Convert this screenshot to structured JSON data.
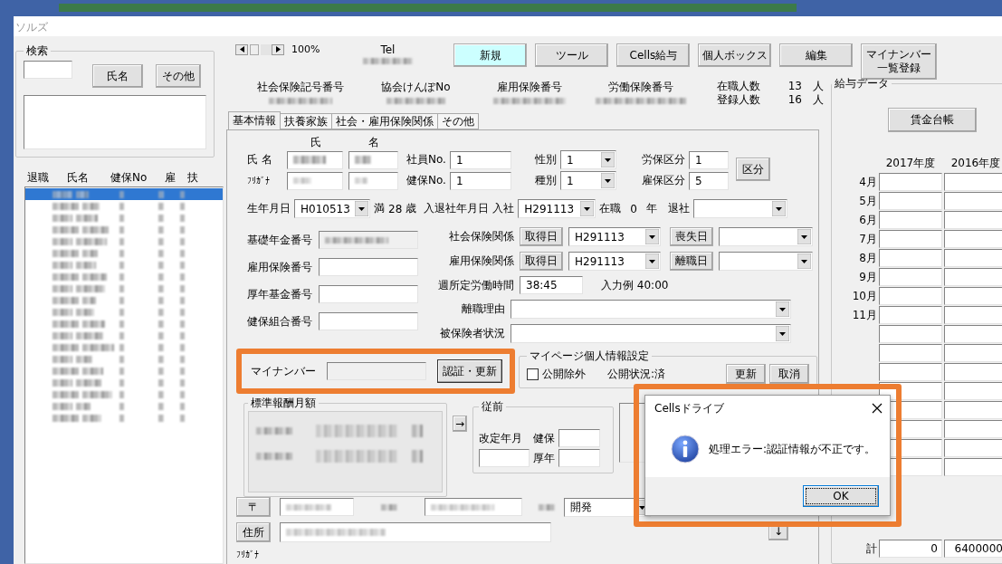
{
  "window": {
    "title": "ソルズ"
  },
  "search": {
    "legend": "検索",
    "buttons": [
      "氏名",
      "その他"
    ]
  },
  "employee_list": {
    "columns": [
      "退職",
      "氏名",
      "健保No",
      "雇",
      "扶"
    ],
    "rows": [
      {
        "selected": true
      },
      {
        "selected": false
      },
      {
        "selected": false
      },
      {
        "selected": false
      },
      {
        "selected": false
      },
      {
        "selected": false
      },
      {
        "selected": false
      },
      {
        "selected": false
      },
      {
        "selected": false
      },
      {
        "selected": false
      },
      {
        "selected": false
      },
      {
        "selected": false
      },
      {
        "selected": false
      },
      {
        "selected": false
      },
      {
        "selected": false
      },
      {
        "selected": false
      },
      {
        "selected": false
      },
      {
        "selected": false
      },
      {
        "selected": false
      },
      {
        "selected": false
      }
    ]
  },
  "zoom": {
    "reading": "100%"
  },
  "tel": {
    "label": "Tel"
  },
  "toolbar": [
    {
      "label": "新規",
      "highlighted": true
    },
    {
      "label": "ツール",
      "highlighted": false
    },
    {
      "label": "Cells給与",
      "highlighted": false
    },
    {
      "label": "個人ボックス",
      "highlighted": false
    },
    {
      "label": "編集",
      "highlighted": false
    },
    {
      "lines": [
        "マイナンバー",
        "一覧登録"
      ],
      "highlighted": false
    }
  ],
  "insurance_numbers": [
    {
      "label": "社会保険記号番号"
    },
    {
      "label": "協会けんぽNo"
    },
    {
      "label": "雇用保険番号"
    },
    {
      "label": "労働保険番号"
    }
  ],
  "headcount": [
    {
      "label": "在職人数",
      "value": "13",
      "unit": "人"
    },
    {
      "label": "登録人数",
      "value": "16",
      "unit": "人"
    }
  ],
  "tabs": [
    {
      "label": "基本情報",
      "selected": true
    },
    {
      "label": "扶養家族",
      "selected": false
    },
    {
      "label": "社会・雇用保険関係",
      "selected": false
    },
    {
      "label": "その他",
      "selected": false
    }
  ],
  "name_block": {
    "col_headers": [
      "氏",
      "名"
    ],
    "name_label": "氏 名",
    "kana_label": "ﾌﾘｶﾞﾅ"
  },
  "id_fields": [
    {
      "label": "社員No.",
      "value": "1"
    },
    {
      "label": "健保No.",
      "value": "1"
    }
  ],
  "type_selects": [
    {
      "label": "性別",
      "value": "1"
    },
    {
      "label": "種別",
      "value": "1"
    }
  ],
  "kubun": [
    {
      "label": "労保区分",
      "value": "1"
    },
    {
      "label": "雇保区分",
      "value": "5"
    }
  ],
  "kubun_button": "区分",
  "birth": {
    "label": "生年月日",
    "value": "H010513",
    "prefix": "満",
    "age": "28",
    "unit": "歳"
  },
  "employment": {
    "label": "入退社年月日",
    "join_label": "入社",
    "join": "H291113",
    "tenure_label": "在職",
    "tenure": "0",
    "tenure_unit": "年",
    "leave_label": "退社"
  },
  "numbers": [
    {
      "label": "基礎年金番号",
      "redacted": true
    },
    {
      "label": "雇用保険番号",
      "redacted": false
    },
    {
      "label": "厚年基金番号",
      "redacted": false
    },
    {
      "label": "健保組合番号",
      "redacted": false
    }
  ],
  "insurance_rows": [
    {
      "label": "社会保険関係",
      "get_button": "取得日",
      "get_date": "H291113",
      "end_button": "喪失日"
    },
    {
      "label": "雇用保険関係",
      "get_button": "取得日",
      "get_date": "H291113",
      "end_button": "離職日"
    }
  ],
  "weekly_hours": {
    "label": "週所定労働時間",
    "value": "38:45",
    "hint": "入力例  40:00"
  },
  "wide_selects": [
    {
      "label": "離職理由"
    },
    {
      "label": "被保険者状況"
    }
  ],
  "my_number": {
    "label": "マイナンバー",
    "disabled": true,
    "button": "認証・更新"
  },
  "mypage": {
    "legend": "マイページ個人情報設定",
    "checkbox": {
      "label": "公開除外",
      "checked": false
    },
    "status": "公開状況:済",
    "buttons": [
      "更新",
      "取消"
    ]
  },
  "standard_pay": {
    "legend": "標準報酬月額",
    "arrow": "→"
  },
  "previous": {
    "legend": "従前",
    "date_label": "改定年月",
    "fields": [
      "健保",
      "厚年"
    ]
  },
  "address": {
    "zip_button": "〒",
    "industry": "開発",
    "address_button": "住所",
    "kana_label": "ﾌﾘｶﾞﾅ",
    "down_button": "↓"
  },
  "salary": {
    "legend": "給与データ",
    "ledger_button": "賃金台帳",
    "years": [
      "2017年度",
      "2016年度"
    ],
    "months": [
      "4月",
      "5月",
      "6月",
      "7月",
      "8月",
      "9月",
      "10月",
      "11月"
    ],
    "total_label": "計",
    "totals": [
      "0",
      "6400000"
    ]
  },
  "dialog": {
    "title": "Cellsドライブ",
    "message": "処理エラー:認証情報が不正です。",
    "button": "OK"
  }
}
